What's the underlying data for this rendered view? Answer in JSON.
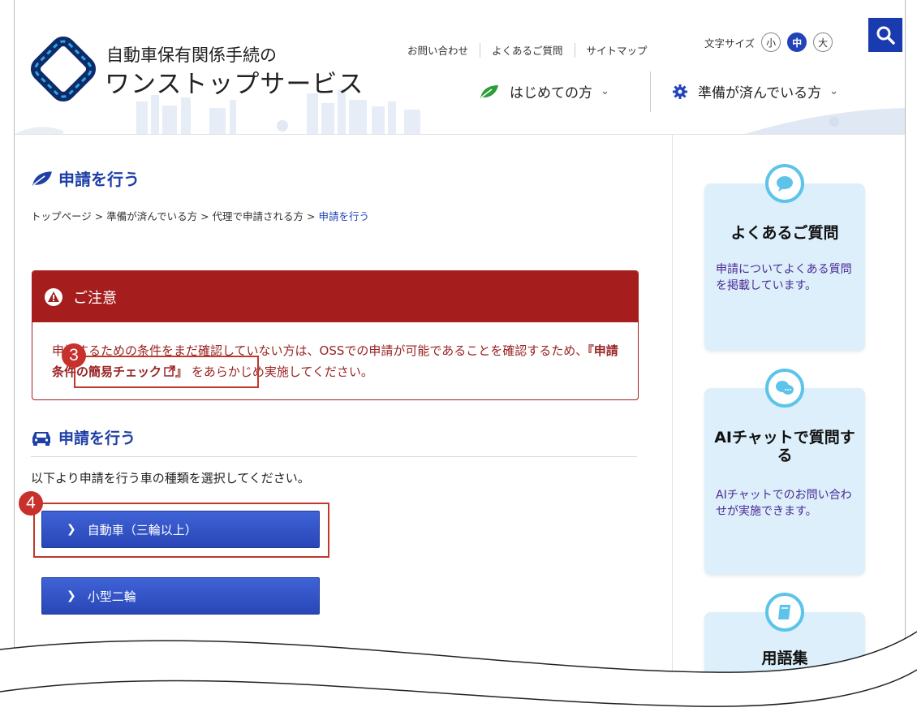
{
  "header": {
    "logo_line1": "自動車保有関係手続の",
    "logo_line2": "ワンストップサービス",
    "util_nav": [
      "お問い合わせ",
      "よくあるご質問",
      "サイトマップ"
    ],
    "font_size_label": "文字サイズ",
    "font_sizes": [
      "小",
      "中",
      "大"
    ],
    "font_size_selected": "中",
    "nav_first_time": "はじめての方",
    "nav_prepared": "準備が済んでいる方"
  },
  "page": {
    "title": "申請を行う",
    "breadcrumb": [
      "トップページ",
      "準備が済んでいる方",
      "代理で申請される方"
    ],
    "breadcrumb_current": "申請を行う"
  },
  "notice": {
    "heading": "ご注意",
    "text_before": "申請するための条件をまだ確認していない方は、OSSでの申請が可能であることを確認するため、",
    "link_text": "『申請条件の簡易チェック",
    "link_close": "』",
    "text_after": "をあらかじめ実施してください。"
  },
  "steps": {
    "step3": "3",
    "step4": "4"
  },
  "section": {
    "title": "申請を行う",
    "instruction": "以下より申請を行う車の種類を選択してください。",
    "btn_car": "自動車（三輪以上）",
    "btn_bike": "小型二輪"
  },
  "sidebar": {
    "faq_title": "よくあるご質問",
    "faq_desc": "申請についてよくある質問を掲載しています。",
    "ai_title": "AIチャットで質問する",
    "ai_desc": "AIチャットでのお問い合わせが実施できます。",
    "glossary_title": "用語集"
  },
  "colors": {
    "primary": "#1e3fa6",
    "notice_red": "#a51d1d",
    "button_blue": "#2946b7",
    "card_bg": "#dceffa"
  }
}
